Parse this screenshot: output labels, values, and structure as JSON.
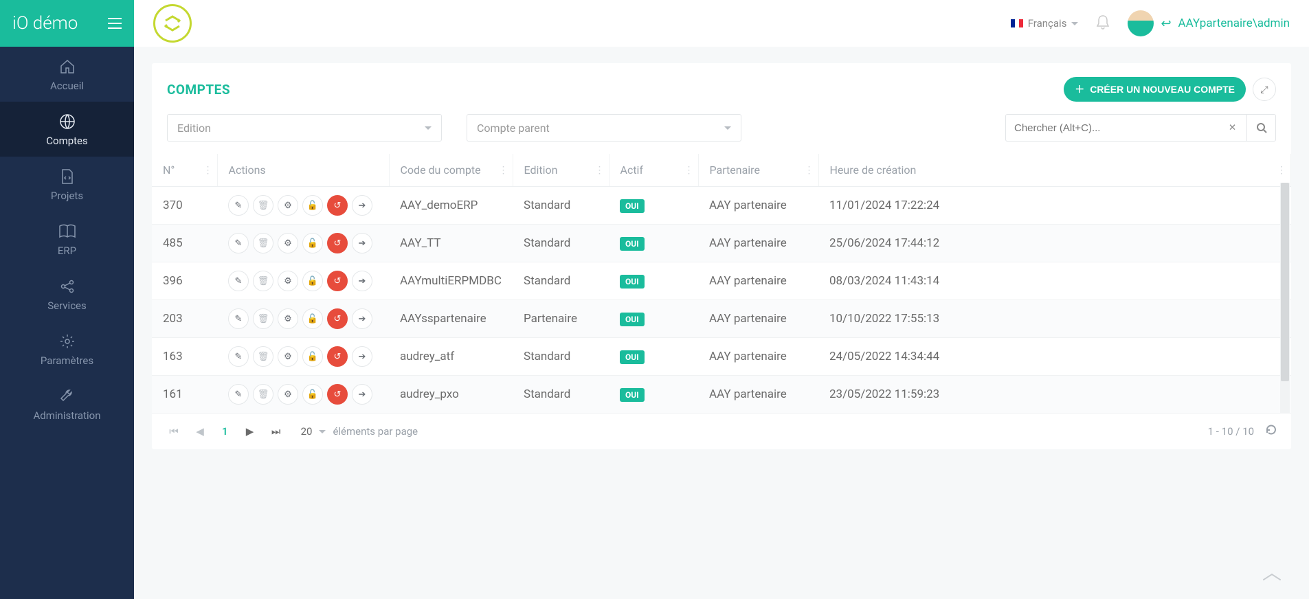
{
  "app_title": "iO démo",
  "sidebar": {
    "items": [
      {
        "label": "Accueil"
      },
      {
        "label": "Comptes"
      },
      {
        "label": "Projets"
      },
      {
        "label": "ERP"
      },
      {
        "label": "Services"
      },
      {
        "label": "Paramètres"
      },
      {
        "label": "Administration"
      }
    ]
  },
  "topbar": {
    "language": "Français",
    "user": "AAYpartenaire\\admin"
  },
  "panel": {
    "title": "COMPTES",
    "create_label": "CRÉER UN NOUVEAU COMPTE"
  },
  "filters": {
    "edition_placeholder": "Edition",
    "parent_placeholder": "Compte parent",
    "search_placeholder": "Chercher (Alt+C)..."
  },
  "columns": {
    "no": "N°",
    "actions": "Actions",
    "code": "Code du compte",
    "edition": "Edition",
    "active": "Actif",
    "partner": "Partenaire",
    "created": "Heure de création"
  },
  "badge_yes": "OUI",
  "rows": [
    {
      "no": "370",
      "code": "AAY_demoERP",
      "edition": "Standard",
      "active": true,
      "partner": "AAY partenaire",
      "created": "11/01/2024 17:22:24"
    },
    {
      "no": "485",
      "code": "AAY_TT",
      "edition": "Standard",
      "active": true,
      "partner": "AAY partenaire",
      "created": "25/06/2024 17:44:12"
    },
    {
      "no": "396",
      "code": "AAYmultiERPMDBC",
      "edition": "Standard",
      "active": true,
      "partner": "AAY partenaire",
      "created": "08/03/2024 11:43:14"
    },
    {
      "no": "203",
      "code": "AAYsspartenaire",
      "edition": "Partenaire",
      "active": true,
      "partner": "AAY partenaire",
      "created": "10/10/2022 17:55:13"
    },
    {
      "no": "163",
      "code": "audrey_atf",
      "edition": "Standard",
      "active": true,
      "partner": "AAY partenaire",
      "created": "24/05/2022 14:34:44"
    },
    {
      "no": "161",
      "code": "audrey_pxo",
      "edition": "Standard",
      "active": true,
      "partner": "AAY partenaire",
      "created": "23/05/2022 11:59:23"
    }
  ],
  "pager": {
    "current_page": "1",
    "page_size": "20",
    "per_page_label": "éléments par page",
    "range": "1 - 10 / 10"
  }
}
